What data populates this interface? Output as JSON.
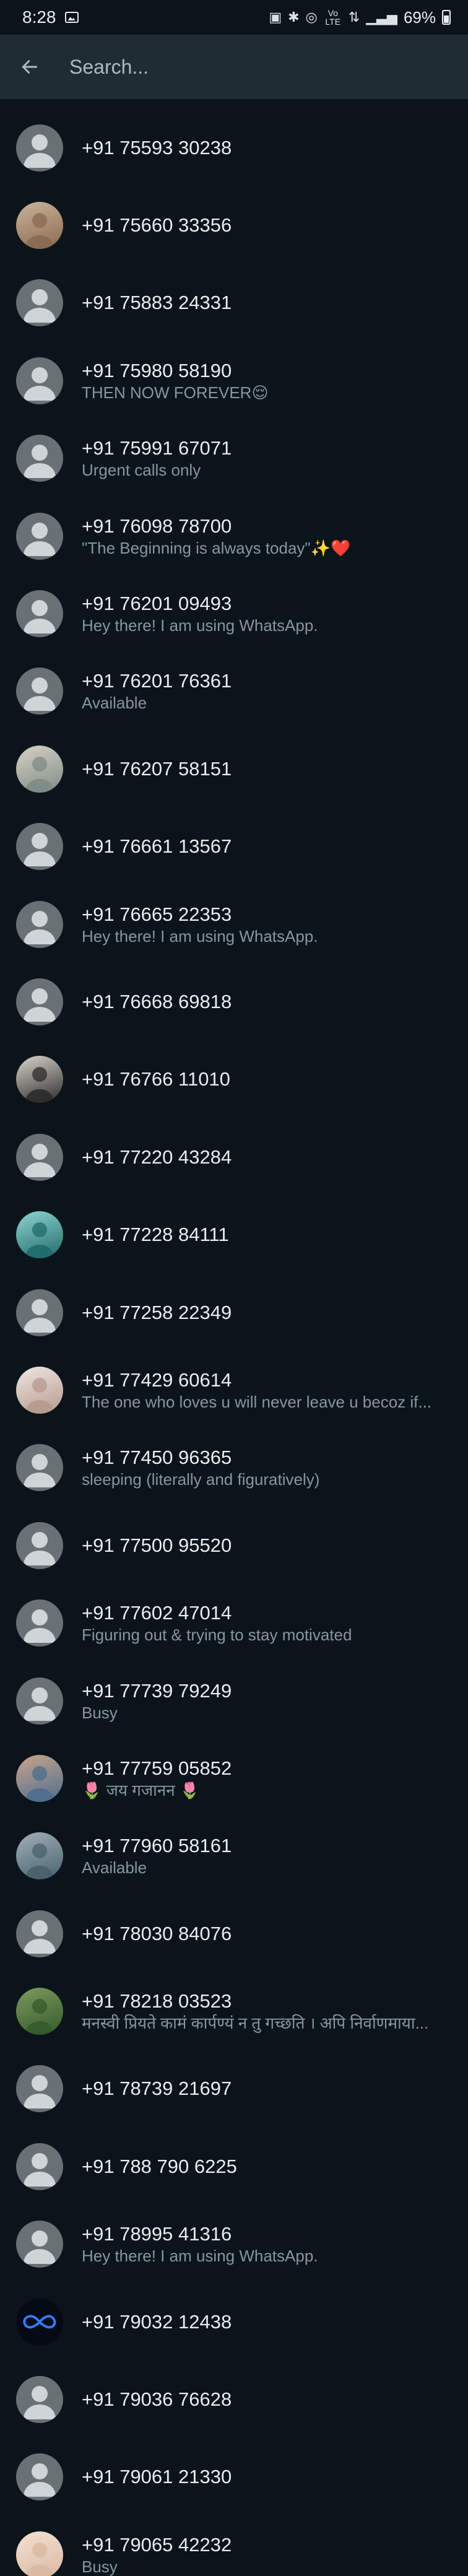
{
  "status_bar": {
    "time": "8:28",
    "network_text": "Vo LTE",
    "battery_percent": "69%"
  },
  "search": {
    "placeholder": "Search..."
  },
  "contacts": [
    {
      "name": "+91 75593 30238",
      "status": "",
      "avatar": "default"
    },
    {
      "name": "+91 75660 33356",
      "status": "",
      "avatar": "photo",
      "colors": [
        "#8a6a4f",
        "#c9b49a"
      ]
    },
    {
      "name": "+91 75883 24331",
      "status": "",
      "avatar": "default"
    },
    {
      "name": "+91 75980 58190",
      "status": "THEN NOW FOREVER😌",
      "avatar": "default"
    },
    {
      "name": "+91 75991 67071",
      "status": "Urgent calls only",
      "avatar": "default"
    },
    {
      "name": "+91 76098 78700",
      "status": "\"The Beginning is always today\"✨❤️",
      "avatar": "default"
    },
    {
      "name": "+91 76201 09493",
      "status": "Hey there! I am using WhatsApp.",
      "avatar": "default"
    },
    {
      "name": "+91 76201 76361",
      "status": "Available",
      "avatar": "default"
    },
    {
      "name": "+91 76207 58151",
      "status": "",
      "avatar": "photo",
      "colors": [
        "#7d8c86",
        "#d7d1c4"
      ]
    },
    {
      "name": "+91 76661 13567",
      "status": "",
      "avatar": "default"
    },
    {
      "name": "+91 76665 22353",
      "status": "Hey there! I am using WhatsApp.",
      "avatar": "default"
    },
    {
      "name": "+91 76668 69818",
      "status": "",
      "avatar": "default"
    },
    {
      "name": "+91 76766 11010",
      "status": "",
      "avatar": "photo",
      "colors": [
        "#2b2b2b",
        "#d9d4cc"
      ]
    },
    {
      "name": "+91 77220 43284",
      "status": "",
      "avatar": "default"
    },
    {
      "name": "+91 77228 84111",
      "status": "",
      "avatar": "photo",
      "colors": [
        "#1f6b6b",
        "#8fd3d0"
      ]
    },
    {
      "name": "+91 77258 22349",
      "status": "",
      "avatar": "default"
    },
    {
      "name": "+91 77429 60614",
      "status": "The one who loves u will never leave u becoz if...",
      "avatar": "photo",
      "colors": [
        "#b69a8e",
        "#efe6e2"
      ]
    },
    {
      "name": "+91 77450 96365",
      "status": "sleeping (literally and figuratively)",
      "avatar": "default"
    },
    {
      "name": "+91 77500 95520",
      "status": "",
      "avatar": "default"
    },
    {
      "name": "+91 77602 47014",
      "status": "Figuring out & trying to stay motivated",
      "avatar": "default"
    },
    {
      "name": "+91 77739 79249",
      "status": "Busy",
      "avatar": "default"
    },
    {
      "name": "+91 77759 05852",
      "status": "🌷 जय गजानन 🌷",
      "avatar": "photo",
      "colors": [
        "#4e6d8f",
        "#c9a58c"
      ]
    },
    {
      "name": "+91 77960 58161",
      "status": "Available",
      "avatar": "photo",
      "colors": [
        "#49616d",
        "#9fb0b8"
      ]
    },
    {
      "name": "+91 78030 84076",
      "status": "",
      "avatar": "default"
    },
    {
      "name": "+91 78218 03523",
      "status": "मनस्वी प्रियते कामं कार्पण्यं न तु गच्छति । अपि निर्वाणमाया...",
      "avatar": "photo",
      "colors": [
        "#355a2b",
        "#7e9a5d"
      ]
    },
    {
      "name": "+91 78739 21697",
      "status": "",
      "avatar": "default"
    },
    {
      "name": "+91 788 790 6225",
      "status": "",
      "avatar": "default"
    },
    {
      "name": "+91 78995 41316",
      "status": "Hey there! I am using WhatsApp.",
      "avatar": "default"
    },
    {
      "name": "+91 79032 12438",
      "status": "",
      "avatar": "infinity",
      "colors": [
        "#050a14",
        "#2f7bff"
      ]
    },
    {
      "name": "+91 79036 76628",
      "status": "",
      "avatar": "default"
    },
    {
      "name": "+91 79061 21330",
      "status": "",
      "avatar": "default"
    },
    {
      "name": "+91 79065 42232",
      "status": "Busy",
      "avatar": "photo",
      "colors": [
        "#d9b9a2",
        "#f3e1d3"
      ]
    }
  ],
  "colors": {
    "background": "#0b141a",
    "search_bar": "#1f2c34",
    "primary_text": "#e9edef",
    "secondary_text": "#8696a0",
    "default_avatar": "#6a7175"
  }
}
